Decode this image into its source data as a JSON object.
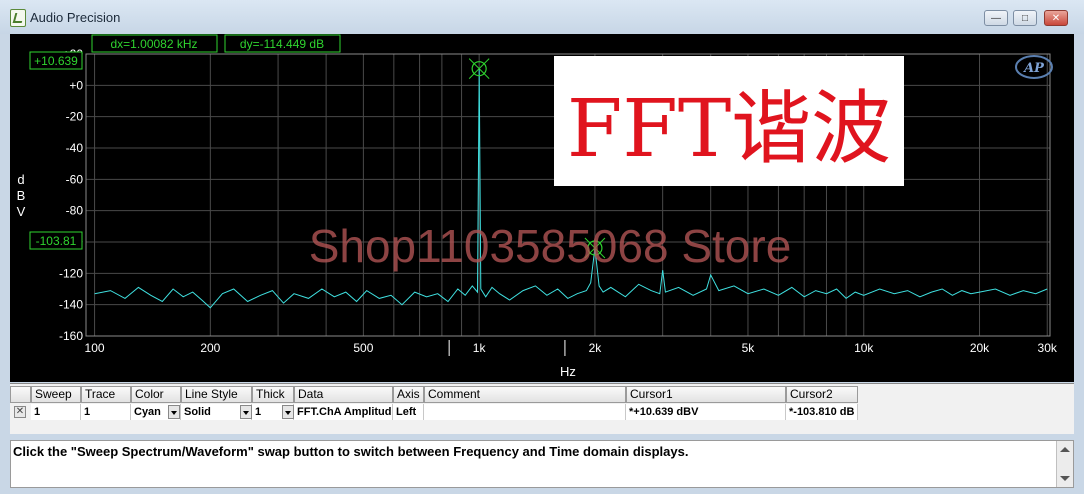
{
  "window": {
    "title": "Audio Precision"
  },
  "readouts": {
    "dx": "dx=1.00082 kHz",
    "dy": "dy=-114.449 dB"
  },
  "cursor_labels": {
    "c1": "+10.639",
    "c2": "-103.81"
  },
  "overlay": {
    "banner": "FFT谐波",
    "watermark": "Shop1103585068 Store",
    "logo": "AP"
  },
  "colors": {
    "trace": "#3fe0e0",
    "grid": "#4a4a4a",
    "axis_text": "#ffffff",
    "readout": "#2fd42f",
    "banner": "#e0141e",
    "watermark": "#b05454"
  },
  "chart_data": {
    "type": "line",
    "title": "",
    "xlabel": "Hz",
    "ylabel": "dBV",
    "xscale": "log",
    "xlim": [
      95,
      30500
    ],
    "ylim": [
      -160,
      20
    ],
    "grid": true,
    "x_ticks": [
      100,
      200,
      500,
      1000,
      2000,
      5000,
      10000,
      20000,
      30000
    ],
    "x_tick_labels": [
      "100",
      "200",
      "500",
      "1k",
      "2k",
      "5k",
      "10k",
      "20k",
      "30k"
    ],
    "x_minor_ticks": [
      300,
      400,
      600,
      700,
      800,
      900,
      3000,
      4000,
      6000,
      7000,
      8000,
      9000
    ],
    "y_ticks": [
      20,
      0,
      -20,
      -40,
      -60,
      -80,
      -100,
      -120,
      -140,
      -160
    ],
    "y_tick_labels": [
      "+20",
      "+0",
      "-20",
      "-40",
      "-60",
      "-80",
      "-100",
      "-120",
      "-140",
      "-160"
    ],
    "series": [
      {
        "name": "FFT.ChA Amplitude",
        "color": "#3fe0e0",
        "x": [
          100,
          110,
          120,
          130,
          140,
          150,
          160,
          170,
          180,
          190,
          200,
          215,
          230,
          250,
          270,
          290,
          310,
          330,
          360,
          390,
          420,
          450,
          480,
          510,
          550,
          590,
          630,
          680,
          730,
          780,
          830,
          880,
          920,
          960,
          990,
          1000,
          1010,
          1040,
          1080,
          1130,
          1200,
          1300,
          1400,
          1500,
          1600,
          1700,
          1800,
          1900,
          1950,
          2000,
          2050,
          2100,
          2200,
          2400,
          2600,
          2800,
          2950,
          3000,
          3050,
          3300,
          3600,
          3900,
          4000,
          4200,
          4600,
          5000,
          5500,
          6000,
          6500,
          7000,
          7500,
          8000,
          8500,
          9000,
          9500,
          10000,
          11000,
          12000,
          13000,
          14000,
          15000,
          16000,
          17000,
          18000,
          19000,
          20000,
          22000,
          24000,
          26000,
          28000,
          30000
        ],
        "y": [
          -133,
          -131,
          -136,
          -129,
          -134,
          -138,
          -130,
          -135,
          -132,
          -137,
          -142,
          -133,
          -130,
          -138,
          -134,
          -131,
          -139,
          -133,
          -136,
          -130,
          -135,
          -132,
          -138,
          -131,
          -136,
          -134,
          -140,
          -132,
          -135,
          -133,
          -138,
          -130,
          -134,
          -128,
          -132,
          10.6,
          -130,
          -135,
          -129,
          -133,
          -137,
          -131,
          -128,
          -134,
          -130,
          -136,
          -133,
          -131,
          -126,
          -103.8,
          -128,
          -132,
          -129,
          -135,
          -127,
          -131,
          -133,
          -118,
          -132,
          -129,
          -134,
          -130,
          -121,
          -131,
          -128,
          -133,
          -130,
          -134,
          -129,
          -135,
          -131,
          -133,
          -130,
          -136,
          -132,
          -134,
          -130,
          -133,
          -131,
          -135,
          -132,
          -130,
          -134,
          -131,
          -133,
          -132,
          -130,
          -134,
          -131,
          -133,
          -130
        ]
      }
    ],
    "markers": [
      {
        "x": 1000,
        "y": 10.639
      },
      {
        "x": 2000,
        "y": -103.81
      }
    ]
  },
  "table": {
    "headers": [
      "Sweep",
      "Trace",
      "Color",
      "Line Style",
      "Thick",
      "Data",
      "Axis",
      "Comment",
      "Cursor1",
      "Cursor2"
    ],
    "row": {
      "sweep": "1",
      "trace": "1",
      "color": "Cyan",
      "line_style": "Solid",
      "thick": "1",
      "data": "FFT.ChA Amplitud",
      "axis": "Left",
      "comment": "",
      "cursor1": "*+10.639  dBV",
      "cursor2": "*-103.810 dB"
    }
  },
  "status": {
    "message": "Click the \"Sweep Spectrum/Waveform\" swap button to switch between Frequency and Time domain displays."
  }
}
